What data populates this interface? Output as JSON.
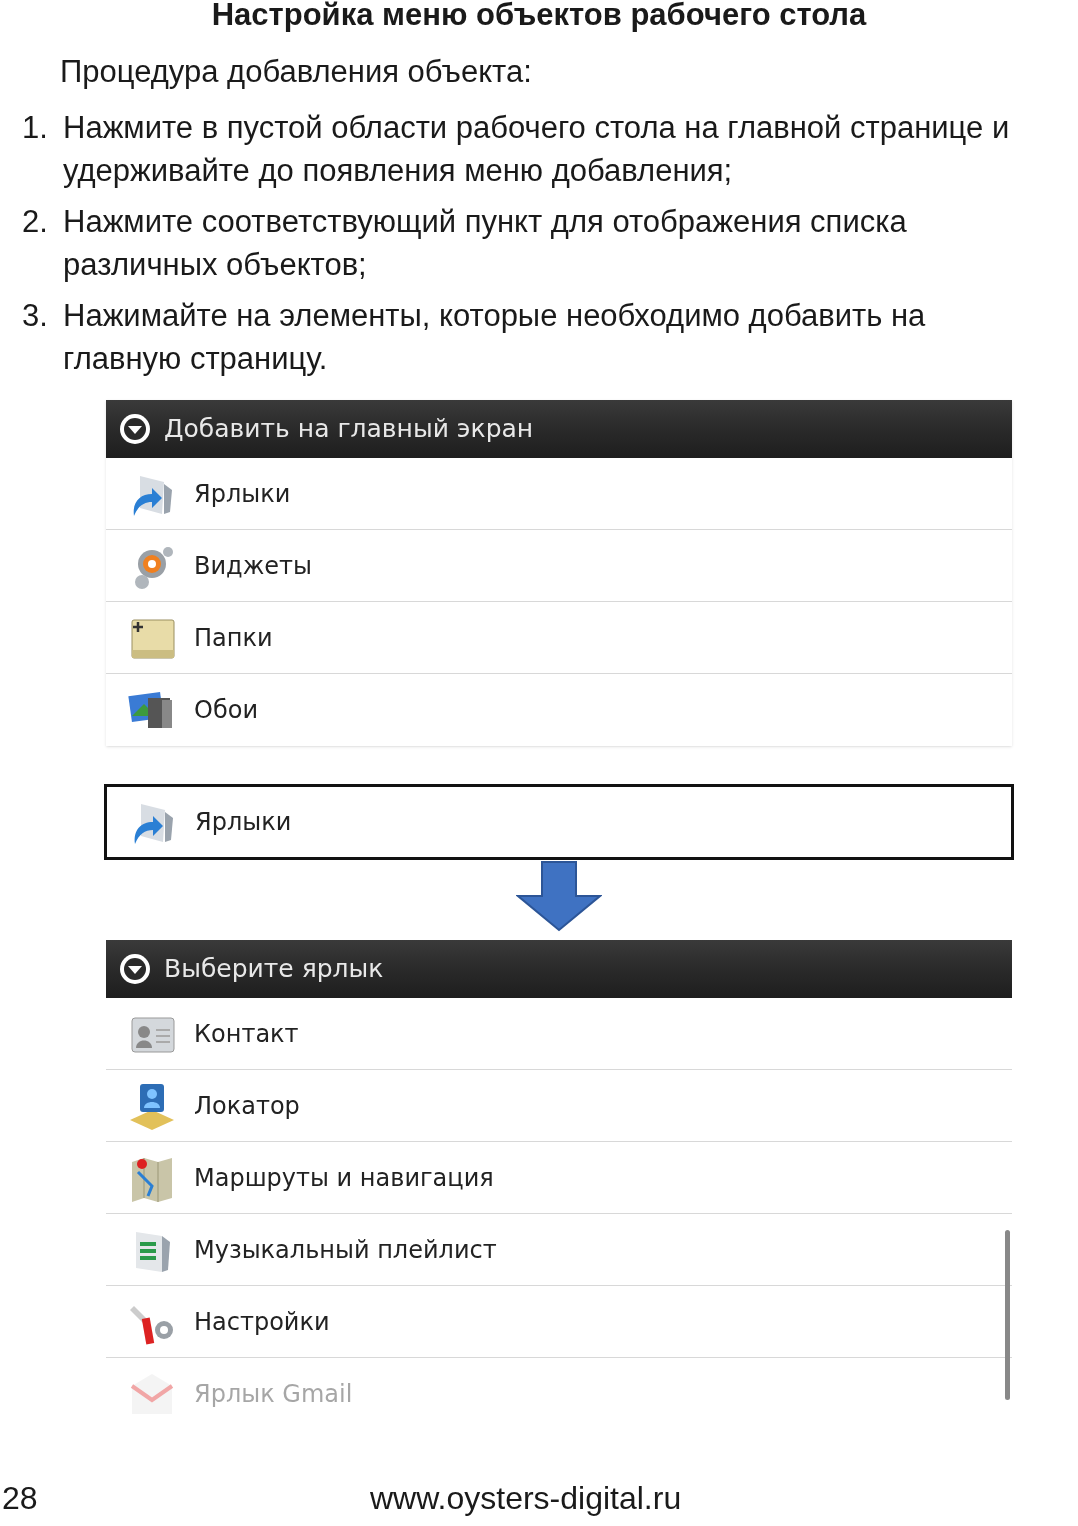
{
  "title": "Настройка меню объектов рабочего стола",
  "intro": "Процедура добавления объекта:",
  "steps": [
    {
      "number": "1.",
      "text": "Нажмите в пустой области рабочего стола на главной странице и удерживайте до появления меню добавления;"
    },
    {
      "number": "2.",
      "text": "Нажмите соответствующий пункт для отображения списка различных объектов;"
    },
    {
      "number": "3.",
      "text": "Нажимайте на элементы, которые необходимо добавить на главную страницу."
    }
  ],
  "add_menu": {
    "title": "Добавить на главный экран",
    "items": [
      {
        "label": "Ярлыки",
        "kind": "shortcut"
      },
      {
        "label": "Виджеты",
        "kind": "widget"
      },
      {
        "label": "Папки",
        "kind": "folder"
      },
      {
        "label": "Обои",
        "kind": "wallpaper"
      }
    ]
  },
  "selected_item": {
    "label": "Ярлыки",
    "kind": "shortcut"
  },
  "shortcut_menu": {
    "title": "Выберите ярлык",
    "items": [
      {
        "label": "Контакт",
        "kind": "contact"
      },
      {
        "label": "Локатор",
        "kind": "locator"
      },
      {
        "label": "Маршруты и навигация",
        "kind": "map"
      },
      {
        "label": "Музыкальный плейлист",
        "kind": "playlist"
      },
      {
        "label": "Настройки",
        "kind": "settings"
      },
      {
        "label": "Ярлык Gmail",
        "kind": "mail"
      }
    ]
  },
  "footer": {
    "page_number": "28",
    "url": "www.oysters-digital.ru"
  }
}
